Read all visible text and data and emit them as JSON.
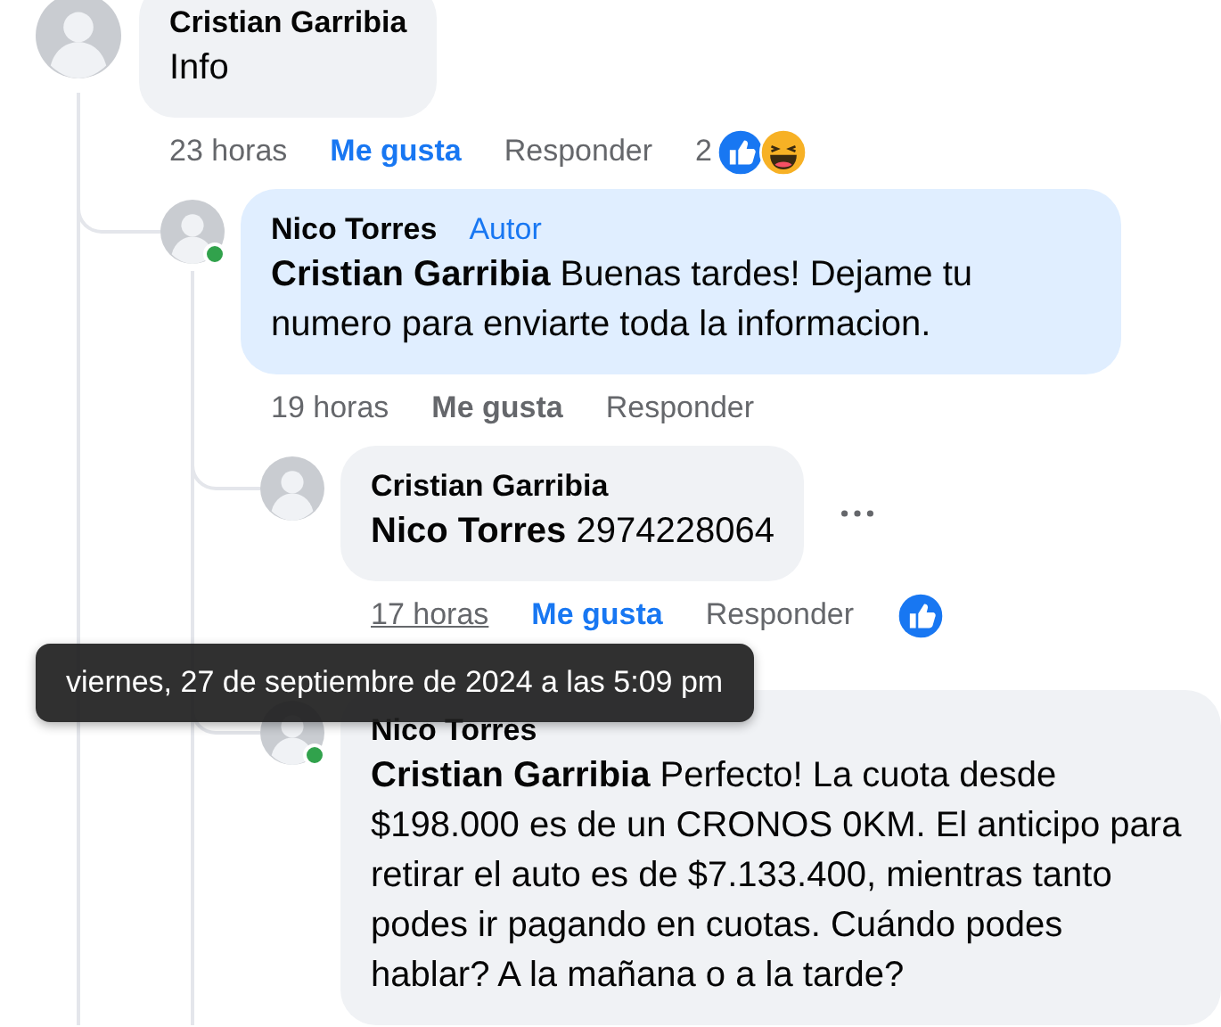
{
  "comments": [
    {
      "author": "Cristian Garribia",
      "highlighted": false,
      "text": "Info",
      "time": "23 horas",
      "time_hovered": false,
      "like_label": "Me gusta",
      "liked": true,
      "reply_label": "Responder",
      "reaction_count": "2",
      "reactions": [
        {
          "kind": "like"
        },
        {
          "kind": "haha"
        }
      ],
      "children": [
        {
          "author": "Nico Torres",
          "badge": "Autor",
          "online": true,
          "highlighted": true,
          "text": "**Cristian Garribia** Buenas tardes! Dejame tu numero para enviarte toda la informacion.",
          "time": "19 horas",
          "time_hovered": false,
          "like_label": "Me gusta",
          "liked": false,
          "reply_label": "Responder",
          "children": [
            {
              "author": "Cristian Garribia",
              "highlighted": false,
              "more_button": true,
              "text": "**Nico Torres** 2974228064",
              "time": "17 horas",
              "time_hovered": true,
              "like_label": "Me gusta",
              "liked": true,
              "reply_label": "Responder",
              "reactions": [
                {
                  "kind": "like"
                }
              ]
            },
            {
              "author": "Nico Torres",
              "online": true,
              "highlighted": false,
              "text": "**Cristian Garribia** Perfecto! La cuota desde $198.000 es de un CRONOS 0KM. El anticipo para retirar el auto es de $7.133.400, mientras tanto podes ir pagando en cuotas. Cuándo podes hablar? A la mañana o a la tarde?"
            }
          ]
        }
      ]
    }
  ],
  "tooltip": "viernes, 27 de septiembre de 2024 a las 5:09 pm"
}
